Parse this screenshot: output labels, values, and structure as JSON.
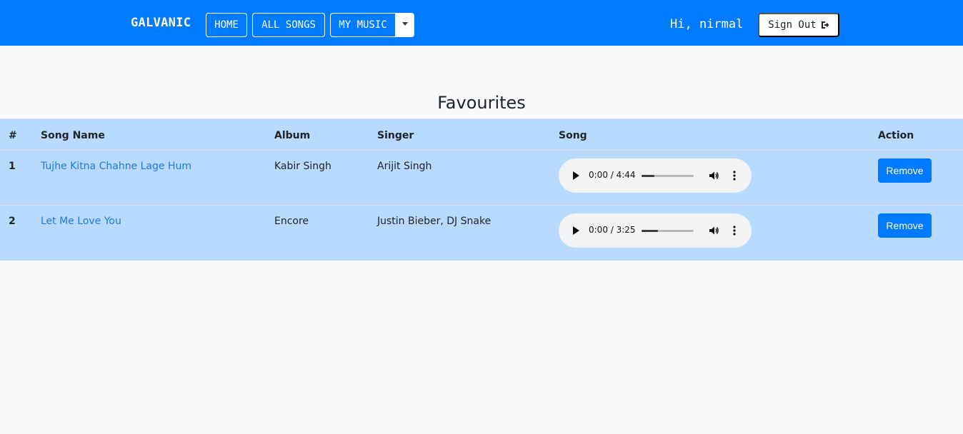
{
  "navbar": {
    "brand": "GALVANIC",
    "home_label": "HOME",
    "all_songs_label": "ALL SONGS",
    "my_music_label": "MY MUSIC",
    "greeting": "Hi, nirmal",
    "signout_label": "Sign Out",
    "signout_icon": "sign-out-icon",
    "color": "#007bff"
  },
  "page": {
    "title": "Favourites"
  },
  "table": {
    "headers": [
      "#",
      "Song Name",
      "Album",
      "Singer",
      "Song",
      "Action"
    ],
    "row_color": "#b8daff",
    "rows": [
      {
        "num": "1",
        "song_name": "Tujhe Kitna Chahne Lage Hum",
        "album": "Kabir Singh",
        "singer": "Arijit Singh",
        "time": "0:00 / 4:44",
        "progress": 0.25,
        "action": "Remove"
      },
      {
        "num": "2",
        "song_name": "Let Me Love You",
        "album": "Encore",
        "singer": "Justin Bieber, DJ Snake",
        "time": "0:00 / 3:25",
        "progress": 0.32,
        "action": "Remove"
      }
    ]
  }
}
